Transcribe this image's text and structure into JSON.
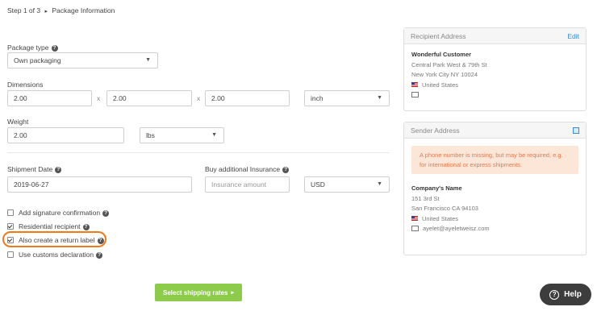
{
  "step": {
    "label": "Step 1 of 3",
    "arrow": "▸",
    "title": "Package Information"
  },
  "package_type": {
    "label": "Package type",
    "value": "Own packaging"
  },
  "dimensions": {
    "label": "Dimensions",
    "length": "2.00",
    "width": "2.00",
    "height": "2.00",
    "sep": "x",
    "unit": "inch"
  },
  "weight": {
    "label": "Weight",
    "value": "2.00",
    "unit": "lbs"
  },
  "shipment_date": {
    "label": "Shipment Date",
    "value": "2019-06-27"
  },
  "insurance": {
    "label": "Buy additional Insurance",
    "placeholder": "Insurance amount",
    "currency": "USD"
  },
  "options": [
    {
      "label": "Add signature confirmation",
      "checked": false
    },
    {
      "label": "Residential recipient",
      "checked": true
    },
    {
      "label": "Also create a return label",
      "checked": true
    },
    {
      "label": "Use customs declaration",
      "checked": false
    }
  ],
  "next_button": {
    "label": "Select shipping rates",
    "arrow": "▸"
  },
  "help": {
    "icon": "?",
    "label": "Help"
  },
  "recipient": {
    "title": "Recipient Address",
    "edit": "Edit",
    "name": "Wonderful Customer",
    "street": "Central Park West & 79th St",
    "city": "New York City NY 10024",
    "country": "United States"
  },
  "sender": {
    "title": "Sender Address",
    "warning": "A phone number is missing, but may be required, e.g. for international or express shipments.",
    "name": "Company's Name",
    "street": "151 3rd St",
    "city": "San Francisco CA 94103",
    "country": "United States",
    "email": "ayelet@ayeletweisz.com"
  },
  "colors": {
    "accent_green": "#8ccc4a",
    "warning_bg": "#fbe6d8",
    "warning_text": "#e8784a",
    "highlight": "#f07a1a"
  }
}
